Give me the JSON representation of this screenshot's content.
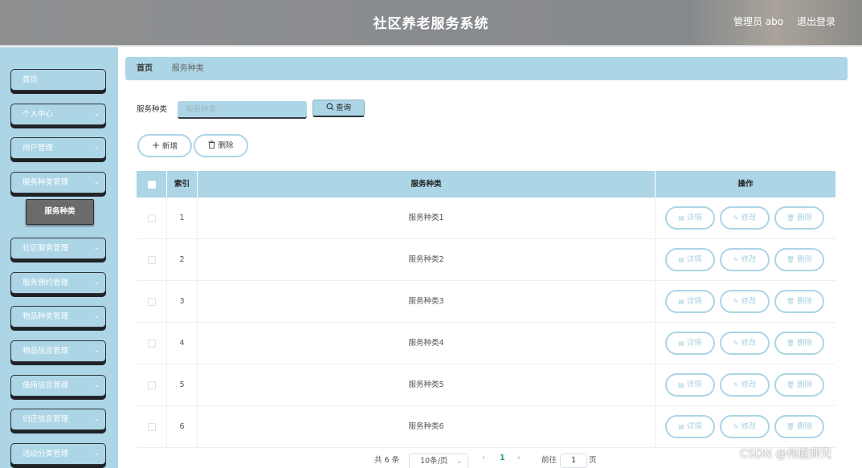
{
  "header": {
    "title": "社区养老服务系统",
    "user": "管理员 abo",
    "logout": "退出登录"
  },
  "sidebar": {
    "items": [
      {
        "label": "首页",
        "has_arrow": false
      },
      {
        "label": "个人中心",
        "has_arrow": true
      },
      {
        "label": "用户管理",
        "has_arrow": true
      },
      {
        "label": "服务种类管理",
        "has_arrow": true
      },
      {
        "label": "社区服务管理",
        "has_arrow": true
      },
      {
        "label": "服务预约管理",
        "has_arrow": true
      },
      {
        "label": "物品种类管理",
        "has_arrow": true
      },
      {
        "label": "物品信息管理",
        "has_arrow": true
      },
      {
        "label": "借用信息管理",
        "has_arrow": true
      },
      {
        "label": "归还信息管理",
        "has_arrow": true
      },
      {
        "label": "活动分类管理",
        "has_arrow": true
      }
    ],
    "active_sub": "服务种类"
  },
  "breadcrumb": {
    "home": "首页",
    "separator": "/",
    "current": "服务种类"
  },
  "search": {
    "label": "服务种类",
    "placeholder": "服务种类",
    "button": "查询"
  },
  "actions": {
    "add": "新增",
    "delete": "删除"
  },
  "table": {
    "columns": [
      "索引",
      "服务种类",
      "操作"
    ],
    "rows": [
      {
        "index": "1",
        "name": "服务种类1"
      },
      {
        "index": "2",
        "name": "服务种类2"
      },
      {
        "index": "3",
        "name": "服务种类3"
      },
      {
        "index": "4",
        "name": "服务种类4"
      },
      {
        "index": "5",
        "name": "服务种类5"
      },
      {
        "index": "6",
        "name": "服务种类6"
      }
    ],
    "row_actions": {
      "detail": "详情",
      "edit": "修改",
      "delete": "删除"
    }
  },
  "pagination": {
    "total": "共 6 条",
    "page_size": "10条/页",
    "current_page": "1",
    "goto_label": "前往",
    "goto_value": "1",
    "page_suffix": "页"
  },
  "watermark": "CSDN @伟庭师兄",
  "colors": {
    "accent": "#acd5e6",
    "header": "#888a8c",
    "active_sub": "#6b6b6b",
    "page_active": "#2a9d8f"
  },
  "icons": {
    "search": "search-icon",
    "add": "plus-icon",
    "delete": "trash-icon",
    "detail": "document-icon",
    "edit": "pencil-icon",
    "chevron": "chevron-down-icon"
  }
}
